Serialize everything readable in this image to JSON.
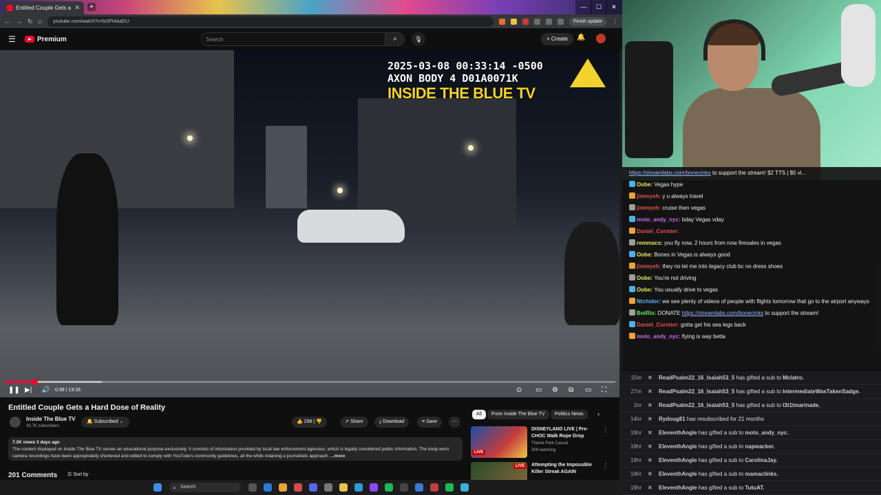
{
  "browser": {
    "tab_title": "Entitled Couple Gets a Hard",
    "url": "youtube.com/watch?v=lsSFt4AaDU",
    "finish_update": "Finish update"
  },
  "youtube": {
    "brand": "Premium",
    "search_placeholder": "Search",
    "create_label": "Create"
  },
  "video": {
    "osd_line1": "2025-03-08 00:33:14 -0500",
    "osd_line2": "AXON BODY 4 D01A0071K",
    "osd_brand": "INSIDE THE BLUE TV",
    "time": "0:39 / 13:16",
    "played_fraction": 0.049,
    "buffered_fraction": 0.16
  },
  "meta": {
    "title": "Entitled Couple Gets a Hard Dose of Reality",
    "channel": "Inside The Blue TV",
    "subs": "43.7K subscribers",
    "subscribed_label": "Subscribed",
    "likes": "298",
    "share": "Share",
    "download": "Download",
    "save": "Save",
    "views_age": "7.2K views  3 days ago",
    "description": "The content displayed on Inside The Blue TV serves an educational purpose exclusively. It consists of information provided by local law enforcement agencies, which is legally considered public information. The body-worn camera recordings have been appropriately shortened and edited to comply with YouTube's community guidelines, all the while retaining a journalistic approach.",
    "more": "...more",
    "comments": "201 Comments",
    "sort_by": "Sort by"
  },
  "chips": [
    "All",
    "From Inside The Blue TV",
    "Politics News"
  ],
  "recs": [
    {
      "title": "DISNEYLAND LIVE | Pre-CHOC Walk Rope Drop",
      "channel": "Theme Park Casual",
      "stat": "309 watching",
      "live": "LIVE"
    },
    {
      "title": "Attempting the Impossible Killer Streak AGAIN",
      "channel": "",
      "stat": "",
      "live": "LIVE"
    }
  ],
  "chat": {
    "header_link": "https://streamlabs.com/bonecinks",
    "header_rest": " to support the stream! $2 TTS | $5 vi...",
    "messages": [
      {
        "user": "Oobe",
        "text": "Vegas hype",
        "color": "#e8e85a"
      },
      {
        "user": "jimmyeh",
        "text": "y u always travel",
        "color": "#e05050"
      },
      {
        "user": "jimmyeh",
        "text": "cruise then vegas",
        "color": "#e05050"
      },
      {
        "user": "moto_andy_nyc",
        "text": "bday Vegas vday",
        "color": "#c56cf0"
      },
      {
        "user": "Daniel_Cormier",
        "text": "",
        "color": "#e05050"
      },
      {
        "user": "remmacs",
        "text": "you fly now, 2 hours from now firesales in vegas",
        "color": "#e8e85a"
      },
      {
        "user": "Oobe",
        "text": "Bones in Vegas is always good",
        "color": "#e8e85a"
      },
      {
        "user": "jimmyeh",
        "text": "they no let me into legacy club bc no dress shoes",
        "color": "#e05050"
      },
      {
        "user": "Oobe",
        "text": "You're not driving",
        "color": "#e8e85a"
      },
      {
        "user": "Oobe",
        "text": "You usually drive to vegas",
        "color": "#e8e85a"
      },
      {
        "user": "Ntchider",
        "text": "we see plenty of videos of people with flights tomorrow that go to the airport anyways",
        "color": "#5ab0f0"
      },
      {
        "user": "BotRix",
        "text": "DONATE ",
        "link": "https://streamlabs.com/bonecinks",
        "after": " to support the stream!",
        "color": "#5ae86a"
      },
      {
        "user": "Daniel_Cormier",
        "text": "gotta get his sea legs back",
        "color": "#e05050"
      },
      {
        "user": "moto_andy_nyc",
        "text": "flying is way betta",
        "color": "#c56cf0"
      }
    ]
  },
  "events": [
    {
      "time": "15m",
      "text": "<b>ReadPsalm22_16_Isaiah53_5</b> has gifted a sub to <b>Mclatro.</b>"
    },
    {
      "time": "27m",
      "text": "<b>ReadPsalm22_16_Isaiah53_5</b> has gifted a sub to <b>IntermediateWasTakenSadge.</b>"
    },
    {
      "time": "1hr",
      "text": "<b>ReadPsalm22_16_Isaiah53_5</b> has gifted a sub to <b>l3t1tmarinade.</b>"
    },
    {
      "time": "14hr",
      "text": "<b>Rydoug81</b> has resubscribed for 21 months"
    },
    {
      "time": "19hr",
      "text": "<b>EleventhAngle</b> has gifted a sub to <b>moto_andy_nyc.</b>"
    },
    {
      "time": "19hr",
      "text": "<b>EleventhAngle</b> has gifted a sub to <b>napwacker.</b>"
    },
    {
      "time": "19hr",
      "text": "<b>EleventhAngle</b> has gifted a sub to <b>CarolinaJay.</b>"
    },
    {
      "time": "19hr",
      "text": "<b>EleventhAngle</b> has gifted a sub to <b>mamaclinks.</b>"
    },
    {
      "time": "19hr",
      "text": "<b>EleventhAngle</b> has gifted a sub to <b>TutuAT.</b>"
    }
  ],
  "taskbar": {
    "search": "Search"
  }
}
